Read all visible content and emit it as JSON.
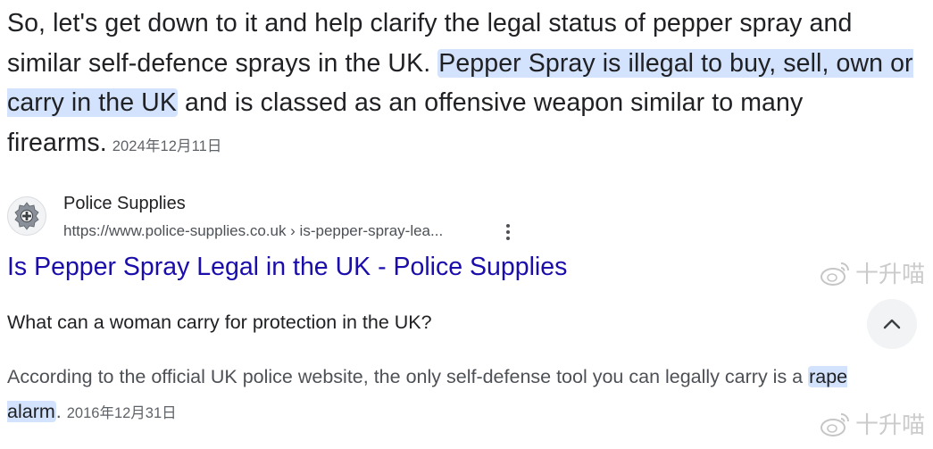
{
  "snippet": {
    "part1": "So, let's get down to it and help clarify the legal status of pepper spray and similar self-defence sprays in the UK. ",
    "highlight": "Pepper Spray is illegal to buy, sell, own or carry in the UK",
    "part2": " and is classed as an offensive weapon similar to many firearms.",
    "date": "2024年12月11日"
  },
  "source": {
    "site_name": "Police Supplies",
    "url": "https://www.police-supplies.co.uk › is-pepper-spray-lea...",
    "icon": "police-badge-icon"
  },
  "result": {
    "title": "Is Pepper Spray Legal in the UK - Police Supplies"
  },
  "faq": {
    "question": "What can a woman carry for protection in the UK?",
    "answer_part1": "According to the official UK police website, the only self-defense tool you can legally carry is a ",
    "answer_highlight": "rape alarm",
    "answer_part2": ".",
    "date": "2016年12月31日"
  },
  "watermark": {
    "text": "十升喵",
    "icon": "weibo-icon"
  },
  "colors": {
    "highlight": "#d3e3fd",
    "link": "#1a0dab"
  }
}
